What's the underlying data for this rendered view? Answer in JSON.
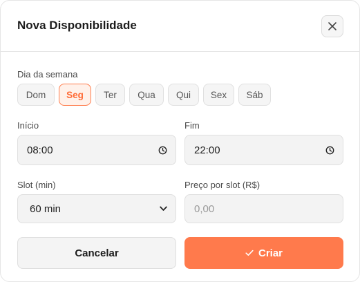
{
  "dialog": {
    "title": "Nova Disponibilidade",
    "close_icon": "close-icon"
  },
  "weekday": {
    "label": "Dia da semana",
    "days": [
      "Dom",
      "Seg",
      "Ter",
      "Qua",
      "Qui",
      "Sex",
      "Sáb"
    ],
    "selected": "Seg"
  },
  "start": {
    "label": "Início",
    "value": "08:00",
    "icon": "clock-icon"
  },
  "end": {
    "label": "Fim",
    "value": "22:00",
    "icon": "clock-icon"
  },
  "slot": {
    "label": "Slot (min)",
    "value": "60 min",
    "icon": "chevron-down-icon"
  },
  "price": {
    "label": "Preço por slot (R$)",
    "placeholder": "0,00"
  },
  "actions": {
    "cancel_label": "Cancelar",
    "create_label": "Criar",
    "create_icon": "check-icon"
  },
  "colors": {
    "accent": "#ff7a4c",
    "accent_light": "#fff1ea",
    "field_bg": "#f3f3f3"
  }
}
